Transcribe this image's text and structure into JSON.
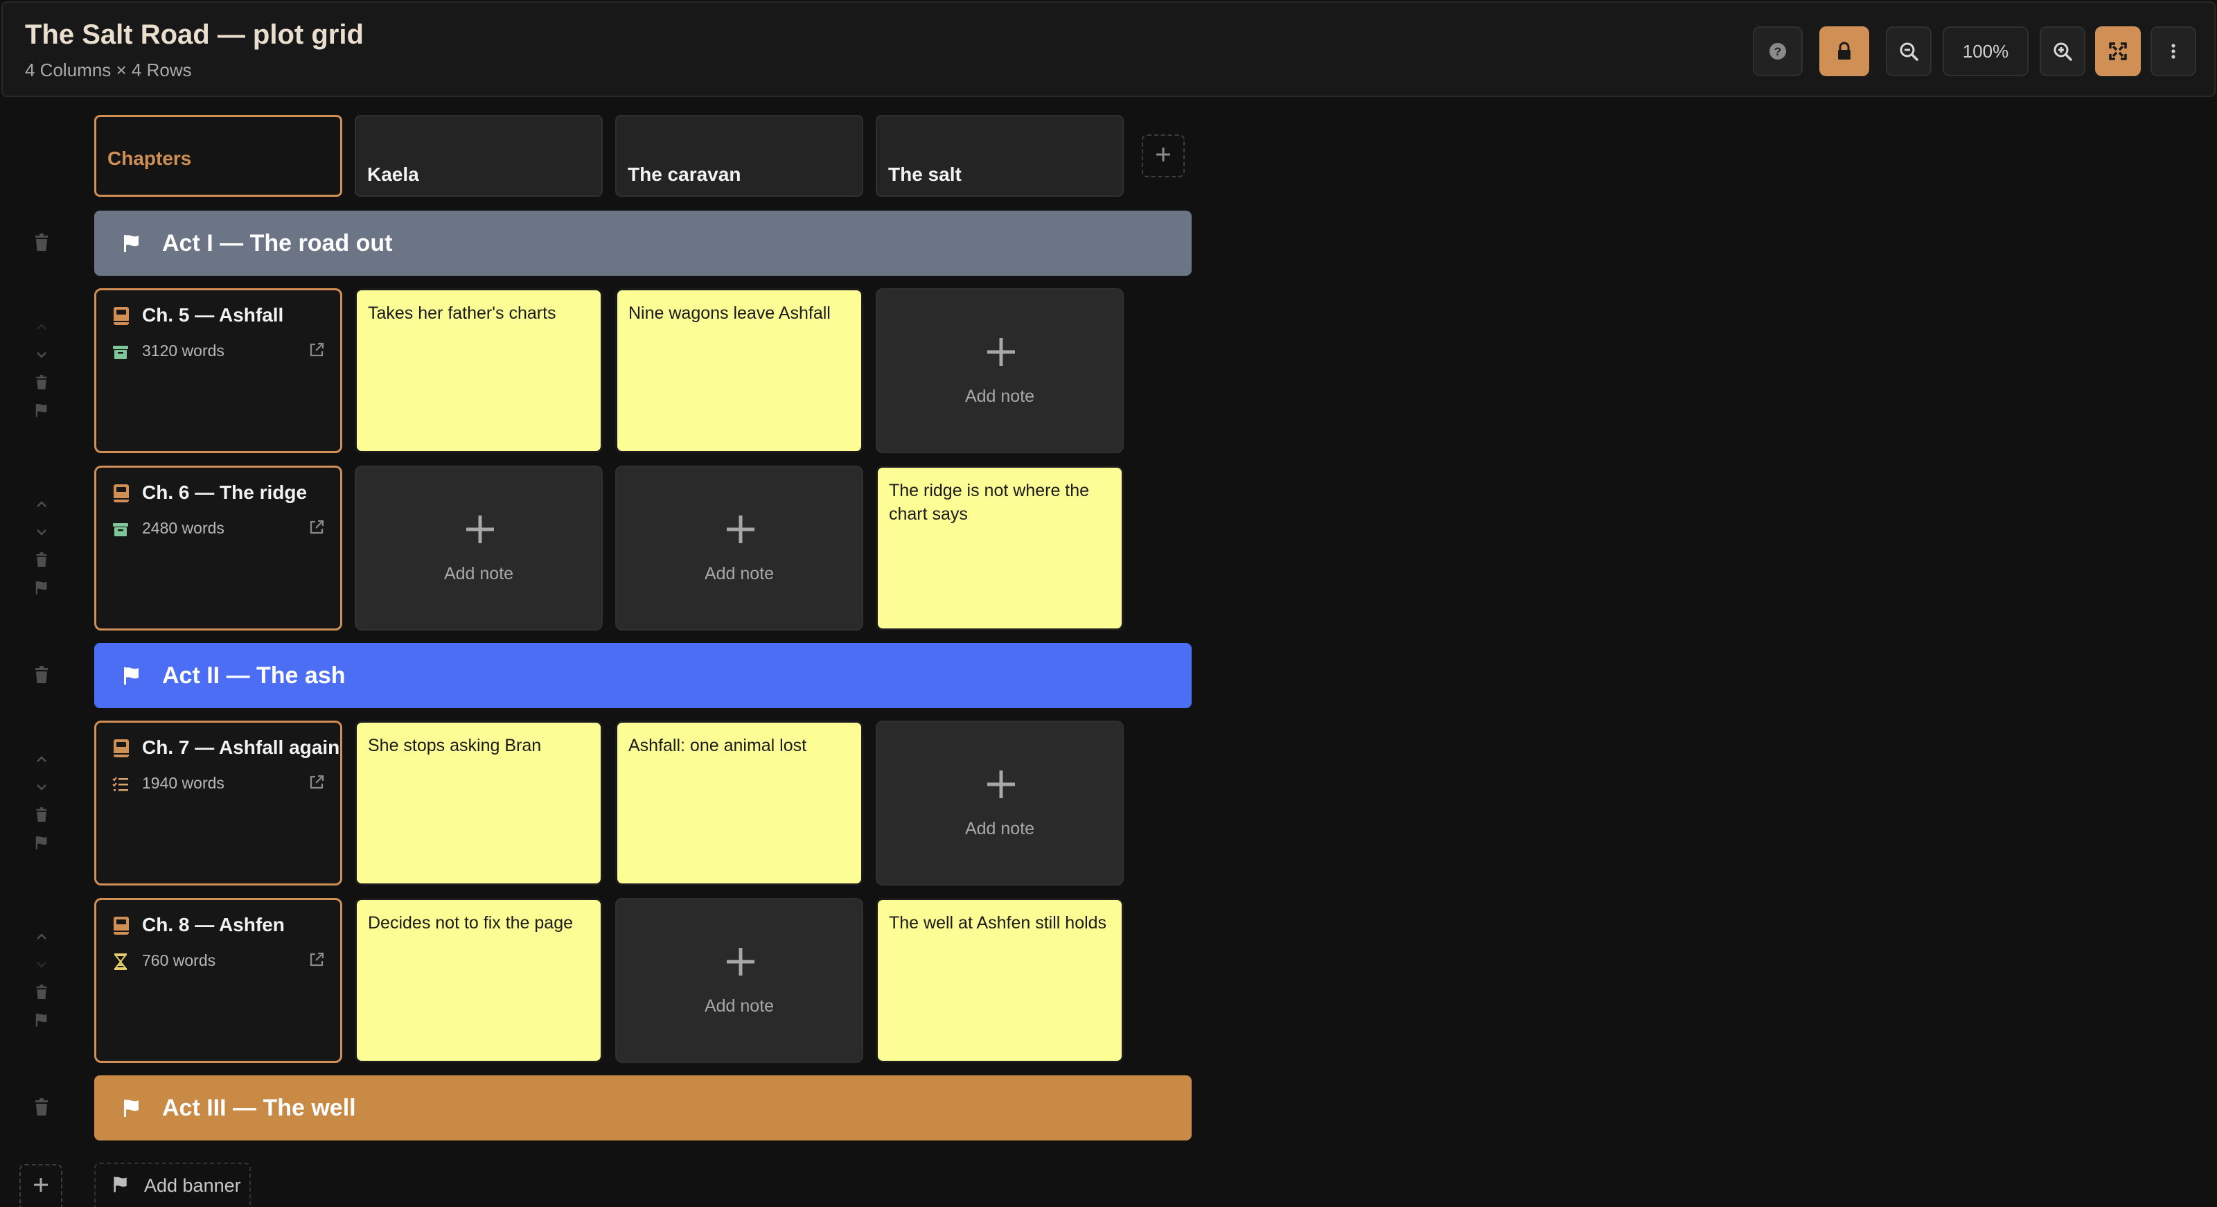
{
  "header": {
    "title": "The Salt Road — plot grid",
    "subtitle": "4 Columns × 4 Rows",
    "zoom": "100%",
    "buttons": [
      "help-icon",
      "lock-icon",
      "zoom-out-icon",
      "zoom-in-icon",
      "fullscreen-icon",
      "more-vertical-icon"
    ]
  },
  "colors": {
    "accent": "#d08f55",
    "note": "#fdfd96",
    "banner_act1": "#6b7585",
    "banner_act2": "#4c6ef5",
    "banner_act3": "#c98a45"
  },
  "columns": {
    "chapters": "Chapters",
    "items": [
      "Kaela",
      "The caravan",
      "The salt"
    ]
  },
  "banners": {
    "act1": "Act I — The road out",
    "act2": "Act II — The ash",
    "act3": "Act III — The well"
  },
  "chapters": [
    {
      "name": "Ch. 5 — Ashfall",
      "words": "3120 words",
      "status_icon": "archive-icon"
    },
    {
      "name": "Ch. 6 — The ridge",
      "words": "2480 words",
      "status_icon": "archive-icon"
    },
    {
      "name": "Ch. 7 — Ashfall again",
      "words": "1940 words",
      "status_icon": "checklist-icon"
    },
    {
      "name": "Ch. 8 — Ashfen",
      "words": "760 words",
      "status_icon": "hourglass-icon"
    }
  ],
  "notes": {
    "r1c1": "Takes her father's charts",
    "r1c2": "Nine wagons leave Ashfall",
    "r2c3": "The ridge is not where the chart says",
    "r3c1": "She stops asking Bran",
    "r3c2": "Ashfall: one animal lost",
    "r4c1": "Decides not to fix the page",
    "r4c3": "The well at Ashfen still holds"
  },
  "add_note_label": "Add note",
  "add_banner_label": "Add banner"
}
